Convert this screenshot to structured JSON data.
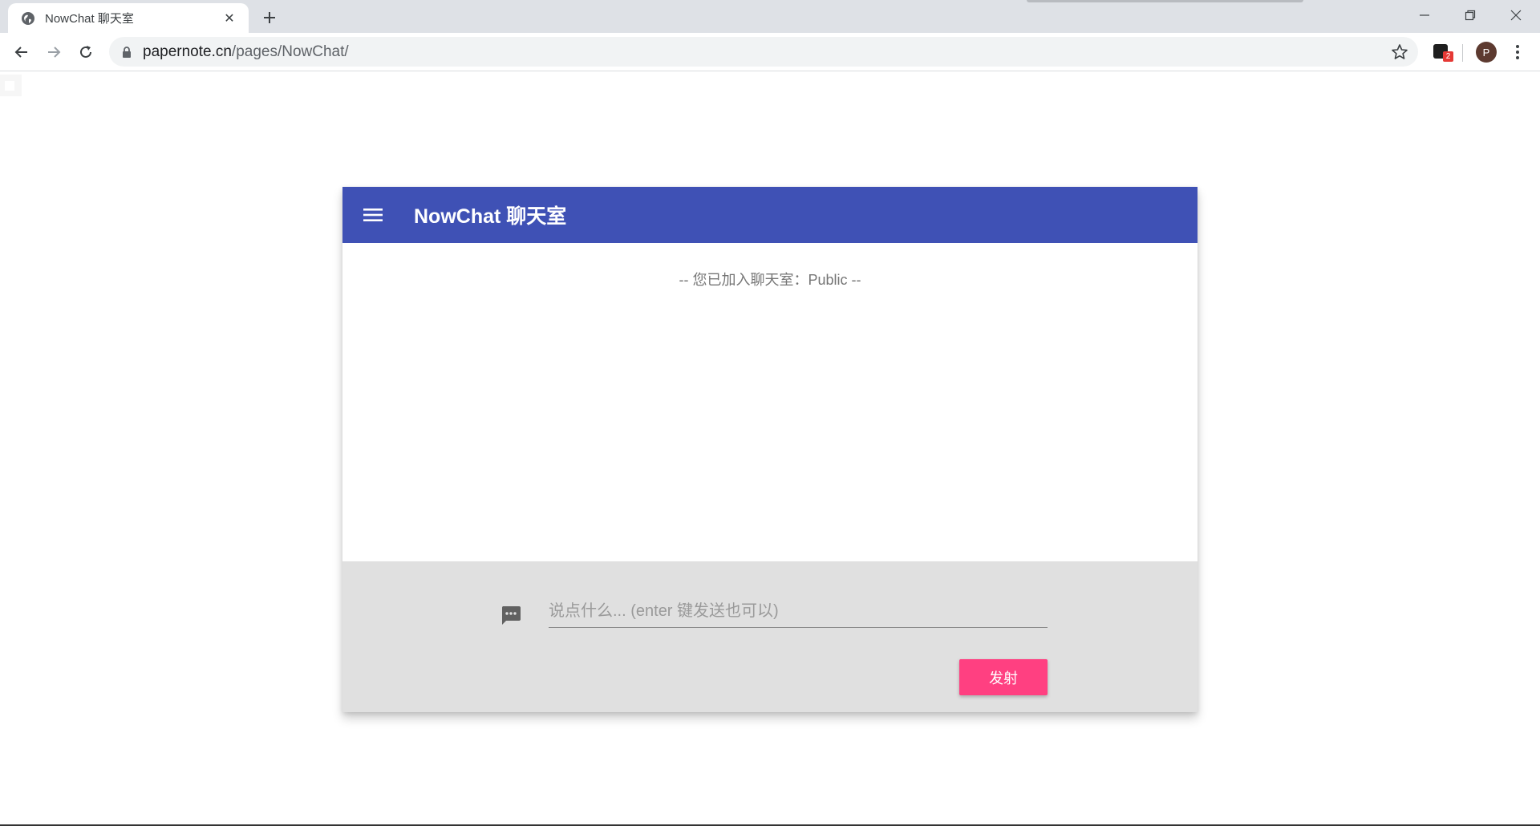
{
  "browser": {
    "tab": {
      "title": "NowChat 聊天室",
      "close_glyph": "✕",
      "favicon": "globe-icon"
    },
    "new_tab_glyph": "+",
    "window_controls": [
      "minimize-icon",
      "restore-icon",
      "close-icon"
    ],
    "url": {
      "host": "papernote.cn",
      "path": "/pages/NowChat/"
    },
    "extension_badge": "2",
    "profile_initial": "P"
  },
  "app": {
    "title": "NowChat 聊天室",
    "accent_color": "#3f51b5",
    "system_message": "-- 您已加入聊天室：Public --",
    "composer": {
      "placeholder": "说点什么... (enter 键发送也可以)",
      "value": "",
      "send_label": "发射",
      "send_color": "#ff4081"
    }
  }
}
